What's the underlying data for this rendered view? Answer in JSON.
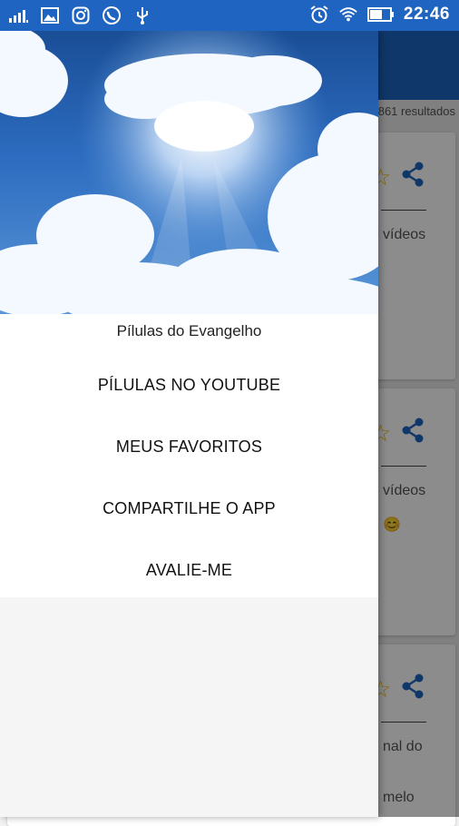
{
  "status_bar": {
    "time": "22:46",
    "left_icons": [
      "signal-icon",
      "gallery-icon",
      "instagram-icon",
      "whatsapp-icon",
      "usb-icon"
    ],
    "right_icons": [
      "alarm-icon",
      "wifi-icon",
      "battery-icon"
    ],
    "color": "#1e64c0"
  },
  "background_app": {
    "results_text": "861 resultados",
    "cards": [
      {
        "line1": "vídeos",
        "line2": ""
      },
      {
        "line1": "vídeos",
        "line2": "😊"
      },
      {
        "line1": "nal do",
        "line2": "melo"
      }
    ]
  },
  "drawer": {
    "header": {
      "image": "sky-clouds-image",
      "title": "Pílulas do Evangelho"
    },
    "menu": [
      {
        "label": "PÍLULAS NO YOUTUBE"
      },
      {
        "label": "MEUS FAVORITOS"
      },
      {
        "label": "COMPARTILHE O APP"
      },
      {
        "label": "AVALIE-ME"
      }
    ]
  }
}
